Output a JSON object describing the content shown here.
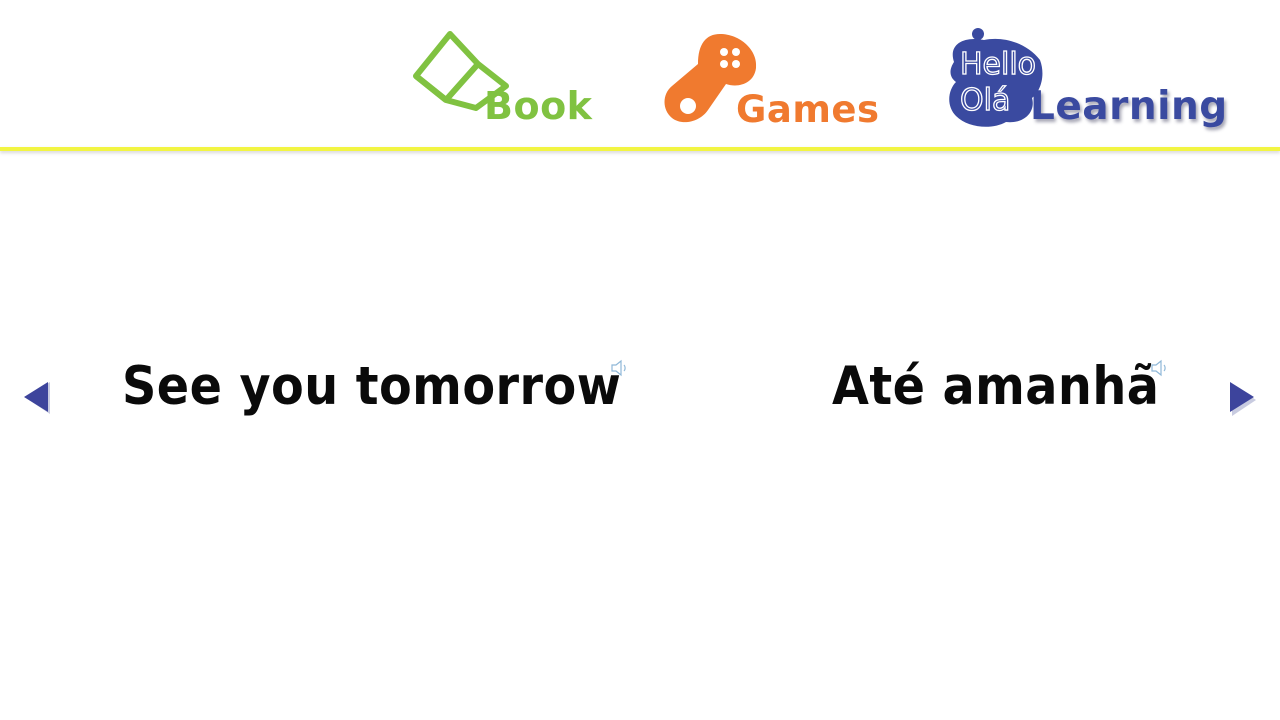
{
  "nav": {
    "book_label": "Book",
    "games_label": "Games",
    "learning_label": "Learning",
    "learning_icon_lines": [
      "Hello",
      "Olá"
    ]
  },
  "phrase": {
    "english": "See you tomorrow",
    "portuguese": "Até amanhã"
  },
  "colors": {
    "book": "#80c241",
    "games": "#f07a2f",
    "learning": "#3a4aa0",
    "arrow": "#3d449c",
    "divider": "#f2f542",
    "speaker": "#8fb8d8"
  },
  "icons": {
    "book": "open-book-icon",
    "games": "gamepad-icon",
    "learning": "speech-bubble-icon",
    "prev": "triangle-left-icon",
    "next": "triangle-right-icon",
    "audio": "speaker-icon"
  }
}
